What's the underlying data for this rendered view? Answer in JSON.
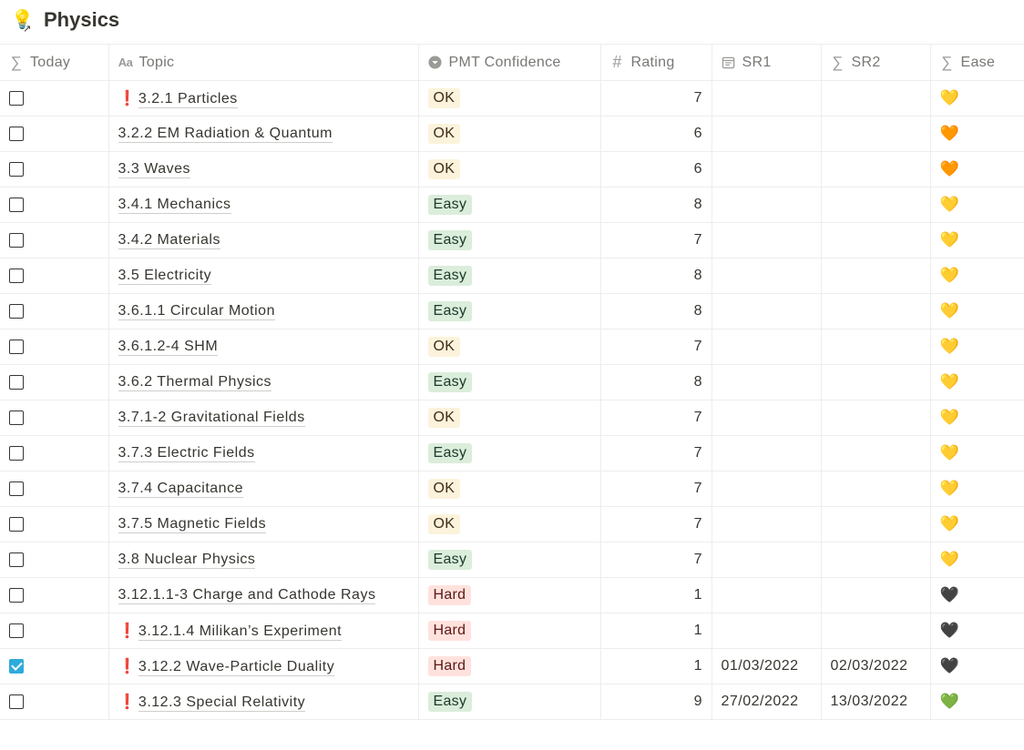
{
  "page": {
    "icon": "lightbulb-icon",
    "title": "Physics"
  },
  "columns": [
    {
      "key": "today",
      "label": "Today",
      "icon": "sigma-icon"
    },
    {
      "key": "topic",
      "label": "Topic",
      "icon": "text-aa-icon"
    },
    {
      "key": "confidence",
      "label": "PMT Confidence",
      "icon": "select-icon"
    },
    {
      "key": "rating",
      "label": "Rating",
      "icon": "hash-icon"
    },
    {
      "key": "sr1",
      "label": "SR1",
      "icon": "calendar-icon"
    },
    {
      "key": "sr2",
      "label": "SR2",
      "icon": "sigma-icon"
    },
    {
      "key": "ease",
      "label": "Ease",
      "icon": "sigma-icon"
    }
  ],
  "colors": {
    "ok": "#fbf3db",
    "easy": "#dbeddb",
    "hard": "#ffe2dd",
    "checkbox_checked": "#2eaadc"
  },
  "rows": [
    {
      "today": false,
      "flag": "❗",
      "topic": "3.2.1 Particles",
      "confidence": "OK",
      "rating": "7",
      "sr1": "",
      "sr2": "",
      "ease": "💛"
    },
    {
      "today": false,
      "flag": "",
      "topic": "3.2.2 EM Radiation & Quantum",
      "confidence": "OK",
      "rating": "6",
      "sr1": "",
      "sr2": "",
      "ease": "🧡"
    },
    {
      "today": false,
      "flag": "",
      "topic": "3.3 Waves",
      "confidence": "OK",
      "rating": "6",
      "sr1": "",
      "sr2": "",
      "ease": "🧡"
    },
    {
      "today": false,
      "flag": "",
      "topic": "3.4.1 Mechanics",
      "confidence": "Easy",
      "rating": "8",
      "sr1": "",
      "sr2": "",
      "ease": "💛"
    },
    {
      "today": false,
      "flag": "",
      "topic": "3.4.2 Materials",
      "confidence": "Easy",
      "rating": "7",
      "sr1": "",
      "sr2": "",
      "ease": "💛"
    },
    {
      "today": false,
      "flag": "",
      "topic": "3.5 Electricity",
      "confidence": "Easy",
      "rating": "8",
      "sr1": "",
      "sr2": "",
      "ease": "💛"
    },
    {
      "today": false,
      "flag": "",
      "topic": "3.6.1.1 Circular Motion",
      "confidence": "Easy",
      "rating": "8",
      "sr1": "",
      "sr2": "",
      "ease": "💛"
    },
    {
      "today": false,
      "flag": "",
      "topic": "3.6.1.2-4 SHM",
      "confidence": "OK",
      "rating": "7",
      "sr1": "",
      "sr2": "",
      "ease": "💛"
    },
    {
      "today": false,
      "flag": "",
      "topic": "3.6.2 Thermal Physics",
      "confidence": "Easy",
      "rating": "8",
      "sr1": "",
      "sr2": "",
      "ease": "💛"
    },
    {
      "today": false,
      "flag": "",
      "topic": "3.7.1-2 Gravitational Fields",
      "confidence": "OK",
      "rating": "7",
      "sr1": "",
      "sr2": "",
      "ease": "💛"
    },
    {
      "today": false,
      "flag": "",
      "topic": "3.7.3 Electric Fields",
      "confidence": "Easy",
      "rating": "7",
      "sr1": "",
      "sr2": "",
      "ease": "💛"
    },
    {
      "today": false,
      "flag": "",
      "topic": "3.7.4 Capacitance",
      "confidence": "OK",
      "rating": "7",
      "sr1": "",
      "sr2": "",
      "ease": "💛"
    },
    {
      "today": false,
      "flag": "",
      "topic": "3.7.5 Magnetic Fields",
      "confidence": "OK",
      "rating": "7",
      "sr1": "",
      "sr2": "",
      "ease": "💛"
    },
    {
      "today": false,
      "flag": "",
      "topic": "3.8 Nuclear Physics",
      "confidence": "Easy",
      "rating": "7",
      "sr1": "",
      "sr2": "",
      "ease": "💛"
    },
    {
      "today": false,
      "flag": "",
      "topic": "3.12.1.1-3 Charge and Cathode Rays",
      "confidence": "Hard",
      "rating": "1",
      "sr1": "",
      "sr2": "",
      "ease": "🖤"
    },
    {
      "today": false,
      "flag": "❗",
      "topic": "3.12.1.4 Milikan’s Experiment",
      "confidence": "Hard",
      "rating": "1",
      "sr1": "",
      "sr2": "",
      "ease": "🖤"
    },
    {
      "today": true,
      "flag": "❗",
      "topic": "3.12.2 Wave-Particle Duality",
      "confidence": "Hard",
      "rating": "1",
      "sr1": "01/03/2022",
      "sr2": "02/03/2022",
      "ease": "🖤"
    },
    {
      "today": false,
      "flag": "❗",
      "topic": "3.12.3 Special Relativity",
      "confidence": "Easy",
      "rating": "9",
      "sr1": "27/02/2022",
      "sr2": "13/03/2022",
      "ease": "💚"
    }
  ]
}
